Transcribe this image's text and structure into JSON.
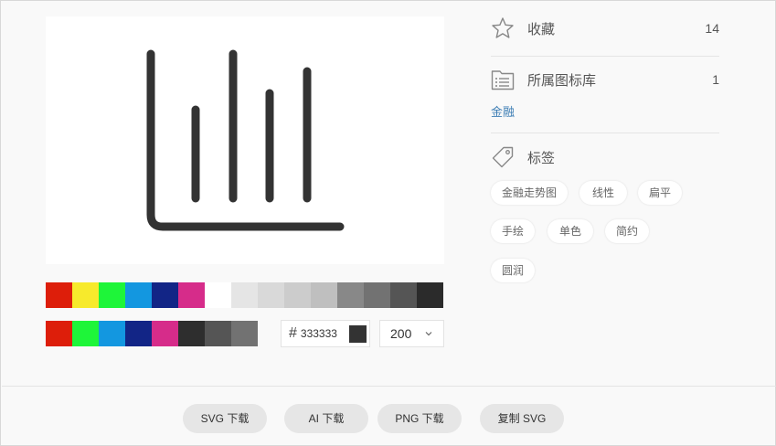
{
  "icon": {
    "name": "bar-chart-linear-icon",
    "color": "#333333"
  },
  "palette_row1": [
    "#dd1e0a",
    "#f7ea2c",
    "#1ef539",
    "#1397e0",
    "#122586",
    "#d62c8a",
    "#ffffff",
    "#e5e5e5",
    "#d9d9d9",
    "#cccccc",
    "#bfbfbf",
    "#888888",
    "#727272",
    "#555555",
    "#2b2b2b"
  ],
  "palette_row2": [
    "#dd1e0a",
    "#1ef539",
    "#1397e0",
    "#122586",
    "#d62c8a",
    "#2e2e2e",
    "#555555",
    "#727272"
  ],
  "color_input": {
    "hash": "#",
    "value": "333333",
    "chip_color": "#333333"
  },
  "size_select": {
    "value": "200"
  },
  "favorites": {
    "label": "收藏",
    "count": "14",
    "icon": "star-icon"
  },
  "library": {
    "label": "所属图标库",
    "count": "1",
    "icon": "library-icon",
    "link": "金融"
  },
  "tags": {
    "label": "标签",
    "icon": "tag-icon",
    "items": [
      "金融走势图",
      "线性",
      "扁平",
      "手绘",
      "单色",
      "简约",
      "圆润"
    ]
  },
  "buttons": {
    "svg": "SVG 下载",
    "ai": "AI 下载",
    "png": "PNG 下载",
    "copy": "复制 SVG"
  }
}
